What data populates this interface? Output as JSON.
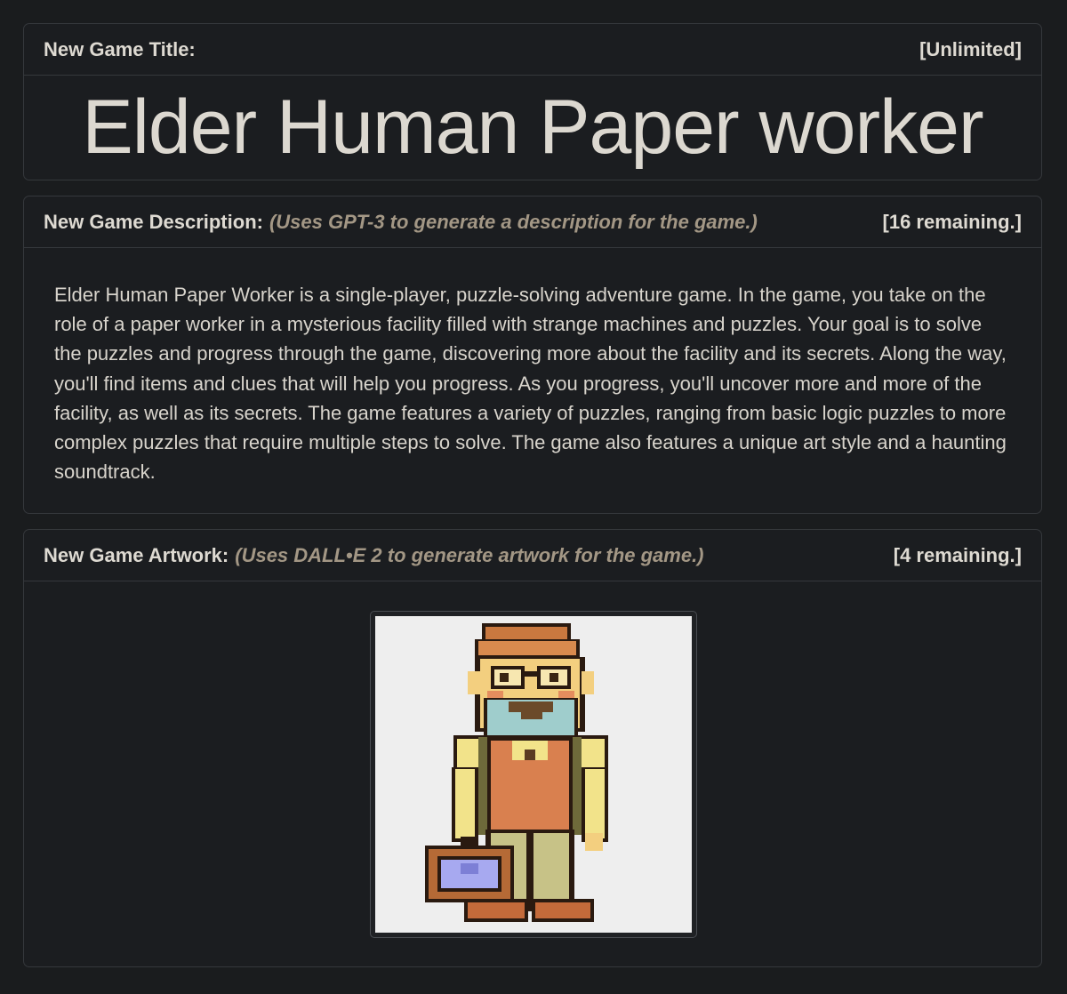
{
  "title_panel": {
    "label": "New Game Title:",
    "quota": "[Unlimited]",
    "game_title": "Elder Human Paper worker"
  },
  "description_panel": {
    "label": "New Game Description:",
    "hint": "(Uses GPT-3 to generate a description for the game.)",
    "quota": "[16 remaining.]",
    "text": "Elder Human Paper Worker is a single-player, puzzle-solving adventure game. In the game, you take on the role of a paper worker in a mysterious facility filled with strange machines and puzzles. Your goal is to solve the puzzles and progress through the game, discovering more about the facility and its secrets. Along the way, you'll find items and clues that will help you progress. As you progress, you'll uncover more and more of the facility, as well as its secrets. The game features a variety of puzzles, ranging from basic logic puzzles to more complex puzzles that require multiple steps to solve. The game also features a unique art style and a haunting soundtrack."
  },
  "artwork_panel": {
    "label": "New Game Artwork:",
    "hint": "(Uses DALL•E 2 to generate artwork for the game.)",
    "quota": "[4 remaining.]",
    "artwork": "pixel-art-elderly-paper-worker"
  },
  "colors": {
    "background": "#1a1c1e",
    "border": "#35383c",
    "text": "#dcd8d0",
    "hint": "#a39785"
  }
}
